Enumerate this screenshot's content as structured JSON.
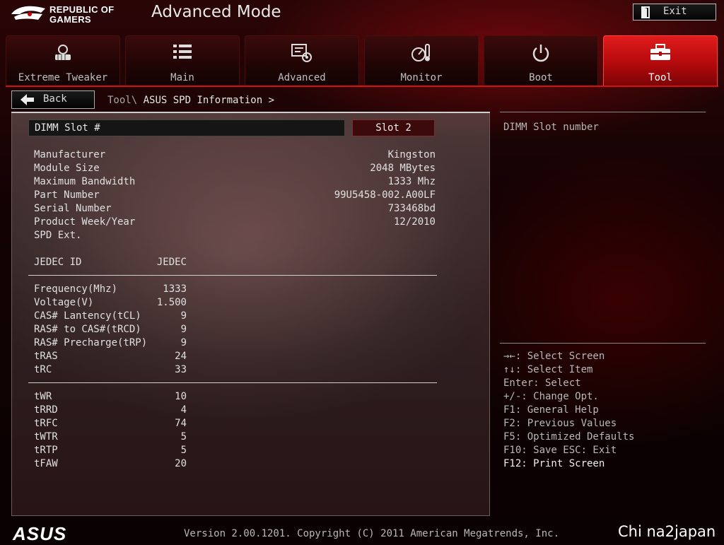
{
  "header": {
    "brand_line1": "REPUBLIC OF",
    "brand_line2": "GAMERS",
    "title": "Advanced Mode",
    "exit_label": "Exit"
  },
  "tabs": [
    {
      "label": "Extreme Tweaker",
      "icon": "tweaker-icon",
      "active": false
    },
    {
      "label": "Main",
      "icon": "list-icon",
      "active": false
    },
    {
      "label": "Advanced",
      "icon": "advanced-settings-icon",
      "active": false
    },
    {
      "label": "Monitor",
      "icon": "monitor-gauge-icon",
      "active": false
    },
    {
      "label": "Boot",
      "icon": "power-icon",
      "active": false
    },
    {
      "label": "Tool",
      "icon": "toolbox-icon",
      "active": true
    }
  ],
  "nav": {
    "back_label": "Back",
    "breadcrumb_parent": "Tool\\",
    "breadcrumb_current": "ASUS SPD Information >"
  },
  "slot": {
    "label": "DIMM Slot #",
    "value": "Slot 2"
  },
  "info": [
    {
      "label": "Manufacturer",
      "value": "Kingston"
    },
    {
      "label": "Module Size",
      "value": "2048 MBytes"
    },
    {
      "label": "Maximum Bandwidth",
      "value": "1333 Mhz"
    },
    {
      "label": "Part Number",
      "value": "99U5458-002.A00LF"
    },
    {
      "label": "Serial Number",
      "value": "733468bd"
    },
    {
      "label": "Product Week/Year",
      "value": "12/2010"
    },
    {
      "label": "SPD Ext.",
      "value": ""
    }
  ],
  "jedec_header": {
    "label": "JEDEC ID",
    "value": "JEDEC"
  },
  "timings_a": [
    {
      "label": "Frequency(Mhz)",
      "value": "1333"
    },
    {
      "label": "Voltage(V)",
      "value": "1.500"
    },
    {
      "label": "CAS# Lantency(tCL)",
      "value": "9"
    },
    {
      "label": "RAS# to CAS#(tRCD)",
      "value": "9"
    },
    {
      "label": "RAS# Precharge(tRP)",
      "value": "9"
    },
    {
      "label": "tRAS",
      "value": "24"
    },
    {
      "label": "tRC",
      "value": "33"
    }
  ],
  "timings_b": [
    {
      "label": "tWR",
      "value": "10"
    },
    {
      "label": "tRRD",
      "value": "4"
    },
    {
      "label": "tRFC",
      "value": "74"
    },
    {
      "label": "tWTR",
      "value": "5"
    },
    {
      "label": "tRTP",
      "value": "5"
    },
    {
      "label": "tFAW",
      "value": "20"
    }
  ],
  "help": {
    "description": "DIMM Slot number",
    "keys": [
      "→←: Select Screen",
      "↑↓: Select Item",
      "Enter: Select",
      "+/-: Change Opt.",
      "F1: General Help",
      "F2: Previous Values",
      "F5: Optimized Defaults",
      "F10: Save  ESC: Exit",
      "F12: Print Screen"
    ]
  },
  "footer": {
    "asus_logo": "ASUS",
    "version": "Version 2.00.1201. Copyright (C) 2011 American Megatrends, Inc.",
    "watermark": "Chi na2japan"
  },
  "colors": {
    "accent": "#d41010",
    "active_tab": "#c8141a",
    "slot_value_bg": "#3d0a0c"
  }
}
